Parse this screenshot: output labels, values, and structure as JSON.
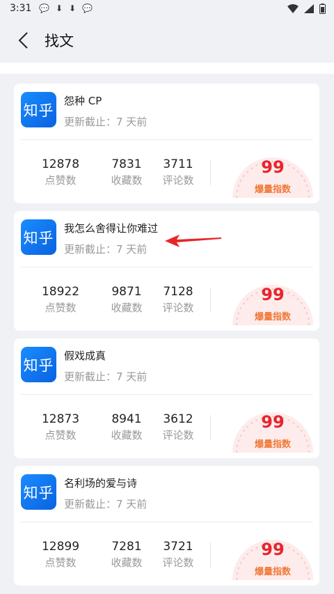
{
  "status_bar": {
    "time": "3:31"
  },
  "header": {
    "title": "找文"
  },
  "colors": {
    "accent_red": "#e9242f",
    "logo_blue": "#0a62e0",
    "gauge_orange": "#f07a3a"
  },
  "cards": [
    {
      "logo": "知乎",
      "title": "怨种 CP",
      "update": "更新截止：7 天前",
      "likes": "12878",
      "likes_label": "点赞数",
      "favorites": "7831",
      "favorites_label": "收藏数",
      "comments": "3711",
      "comments_label": "评论数",
      "score": "99",
      "score_label": "爆量指数"
    },
    {
      "logo": "知乎",
      "title": "我怎么舍得让你难过",
      "update": "更新截止：7 天前",
      "likes": "18922",
      "likes_label": "点赞数",
      "favorites": "9871",
      "favorites_label": "收藏数",
      "comments": "7128",
      "comments_label": "评论数",
      "score": "99",
      "score_label": "爆量指数"
    },
    {
      "logo": "知乎",
      "title": "假戏成真",
      "update": "更新截止：7 天前",
      "likes": "12873",
      "likes_label": "点赞数",
      "favorites": "8941",
      "favorites_label": "收藏数",
      "comments": "3612",
      "comments_label": "评论数",
      "score": "99",
      "score_label": "爆量指数"
    },
    {
      "logo": "知乎",
      "title": "名利场的爱与诗",
      "update": "更新截止：7 天前",
      "likes": "12899",
      "likes_label": "点赞数",
      "favorites": "7281",
      "favorites_label": "收藏数",
      "comments": "3721",
      "comments_label": "评论数",
      "score": "99",
      "score_label": "爆量指数"
    }
  ]
}
